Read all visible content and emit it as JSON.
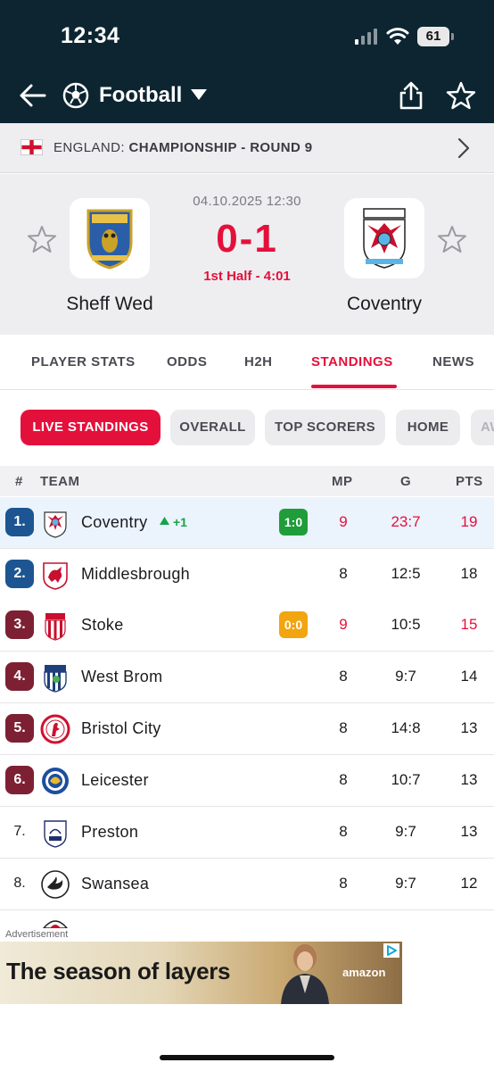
{
  "status_bar": {
    "time": "12:34",
    "battery": "61"
  },
  "nav": {
    "title": "Football"
  },
  "league": {
    "country": "ENGLAND:",
    "competition": "CHAMPIONSHIP - ROUND 9"
  },
  "match": {
    "home": "Sheff Wed",
    "away": "Coventry",
    "date": "04.10.2025 12:30",
    "score": "0-1",
    "status": "1st Half - 4:01"
  },
  "tabs": [
    "PLAYER STATS",
    "ODDS",
    "H2H",
    "STANDINGS",
    "NEWS"
  ],
  "chips": [
    "LIVE STANDINGS",
    "OVERALL",
    "TOP SCORERS",
    "HOME",
    "AWAY"
  ],
  "table": {
    "headers": {
      "rank": "#",
      "team": "TEAM",
      "mp": "MP",
      "g": "G",
      "pts": "PTS"
    },
    "rows": [
      {
        "rank": "1.",
        "team": "Coventry",
        "move": "+1",
        "live": "1:0",
        "mp": "9",
        "g": "23:7",
        "pts": "19"
      },
      {
        "rank": "2.",
        "team": "Middlesbrough",
        "mp": "8",
        "g": "12:5",
        "pts": "18"
      },
      {
        "rank": "3.",
        "team": "Stoke",
        "live": "0:0",
        "mp": "9",
        "g": "10:5",
        "pts": "15"
      },
      {
        "rank": "4.",
        "team": "West Brom",
        "mp": "8",
        "g": "9:7",
        "pts": "14"
      },
      {
        "rank": "5.",
        "team": "Bristol City",
        "mp": "8",
        "g": "14:8",
        "pts": "13"
      },
      {
        "rank": "6.",
        "team": "Leicester",
        "mp": "8",
        "g": "10:7",
        "pts": "13"
      },
      {
        "rank": "7.",
        "team": "Preston",
        "mp": "8",
        "g": "9:7",
        "pts": "13"
      },
      {
        "rank": "8.",
        "team": "Swansea",
        "mp": "8",
        "g": "9:7",
        "pts": "12"
      }
    ]
  },
  "ad": {
    "label": "Advertisement",
    "headline": "The season of layers",
    "brand": "amazon"
  },
  "colors": {
    "accent": "#e4103c",
    "header_bg": "#0c2531",
    "promotion": "#1c5591",
    "playoff": "#7d2033",
    "win_badge": "#1f9d3a",
    "draw_badge": "#f1a50f",
    "move_up": "#17a34a"
  }
}
